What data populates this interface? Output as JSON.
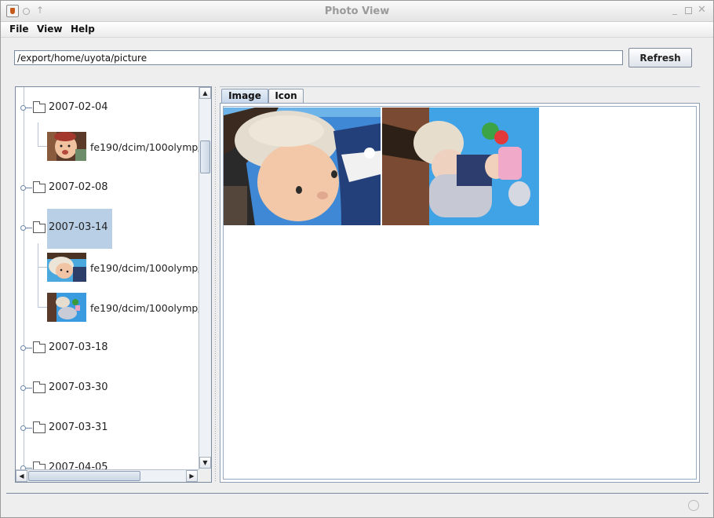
{
  "window": {
    "title": "Photo View"
  },
  "menu": {
    "file": "File",
    "view": "View",
    "help": "Help"
  },
  "path_bar": {
    "path": "/export/home/uyota/picture",
    "refresh_label": "Refresh"
  },
  "tree": {
    "nodes": [
      {
        "label": "2007-02-04",
        "children": [
          "fe190/dcim/100olymp/"
        ]
      },
      {
        "label": "2007-02-08",
        "children": []
      },
      {
        "label": "2007-03-14",
        "selected": true,
        "children": [
          "fe190/dcim/100olymp/",
          "fe190/dcim/100olymp/"
        ]
      },
      {
        "label": "2007-03-18",
        "children": []
      },
      {
        "label": "2007-03-30",
        "children": []
      },
      {
        "label": "2007-03-31",
        "children": []
      },
      {
        "label": "2007-04-05",
        "children": []
      }
    ]
  },
  "tabs": {
    "image": "Image",
    "icon": "Icon",
    "active": "Image"
  },
  "colors": {
    "selection": "#b8cfe5",
    "accent_border": "#7a8aa0"
  }
}
